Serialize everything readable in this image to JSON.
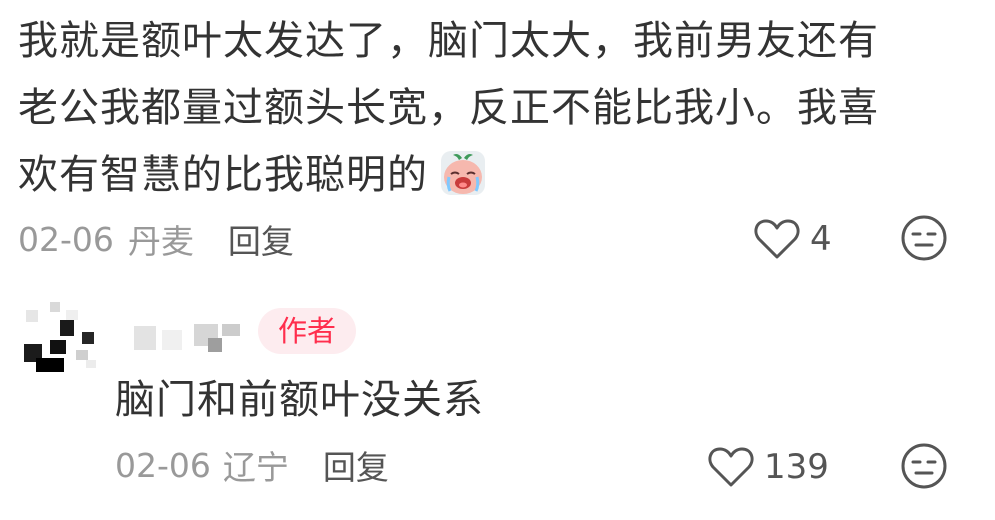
{
  "comment": {
    "lines": [
      "我就是额叶太发达了，脑门太大，我前男友还有",
      "老公我都量过额头长宽，反正不能比我小。我喜",
      "欢有智慧的比我聪明的"
    ],
    "date": "02-06",
    "location": "丹麦",
    "reply_label": "回复",
    "like_count": "4"
  },
  "reply": {
    "author_badge": "作者",
    "text": "脑门和前额叶没关系",
    "date": "02-06",
    "location": "辽宁",
    "reply_label": "回复",
    "like_count": "139"
  },
  "icons": {
    "emoji": "crying-face-emoji",
    "like": "heart-outline-icon",
    "reaction": "neutral-face-icon"
  },
  "colors": {
    "text": "#333333",
    "meta": "#999999",
    "badge_text": "#ff2e4d",
    "badge_bg": "#fdecef"
  }
}
